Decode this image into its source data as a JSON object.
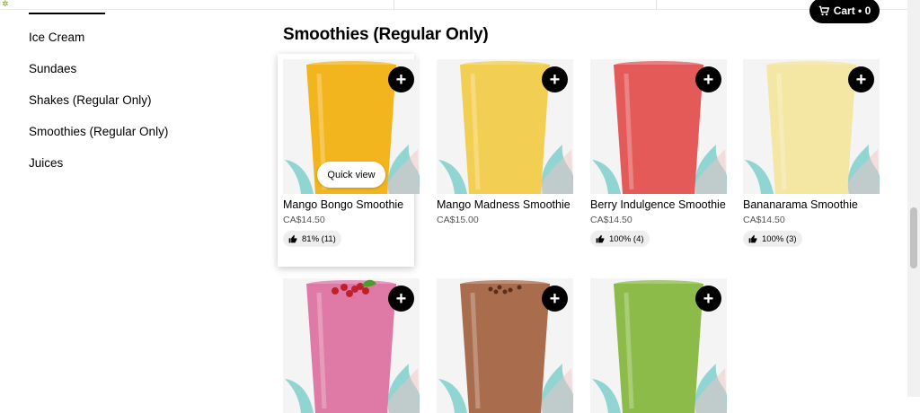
{
  "cart": {
    "label": "Cart • 0"
  },
  "sidebar": {
    "items": [
      {
        "label": "Ice Cream"
      },
      {
        "label": "Sundaes"
      },
      {
        "label": "Shakes (Regular Only)"
      },
      {
        "label": "Smoothies (Regular Only)"
      },
      {
        "label": "Juices"
      }
    ]
  },
  "section": {
    "title": "Smoothies (Regular Only)"
  },
  "products": [
    {
      "name": "Mango Bongo Smoothie",
      "price": "CA$14.50",
      "rating": "81% (11)",
      "quick_view": "Quick view",
      "color": "#f3b51e"
    },
    {
      "name": "Mango Madness Smoothie",
      "price": "CA$15.00",
      "rating": "",
      "color": "#f2cf52"
    },
    {
      "name": "Berry Indulgence Smoothie",
      "price": "CA$14.50",
      "rating": "100% (4)",
      "color": "#e35a59"
    },
    {
      "name": "Bananarama Smoothie",
      "price": "CA$14.50",
      "rating": "100% (3)",
      "color": "#f4e6a3"
    },
    {
      "name": "",
      "price": "",
      "rating": "",
      "color": "#de7aa5"
    },
    {
      "name": "",
      "price": "",
      "rating": "",
      "color": "#a96d4d"
    },
    {
      "name": "",
      "price": "",
      "rating": "",
      "color": "#8dbb4a"
    }
  ],
  "colors": {
    "accent": "#000000",
    "leaf": "#7fcfcd",
    "splash": "#f0c4c4"
  }
}
